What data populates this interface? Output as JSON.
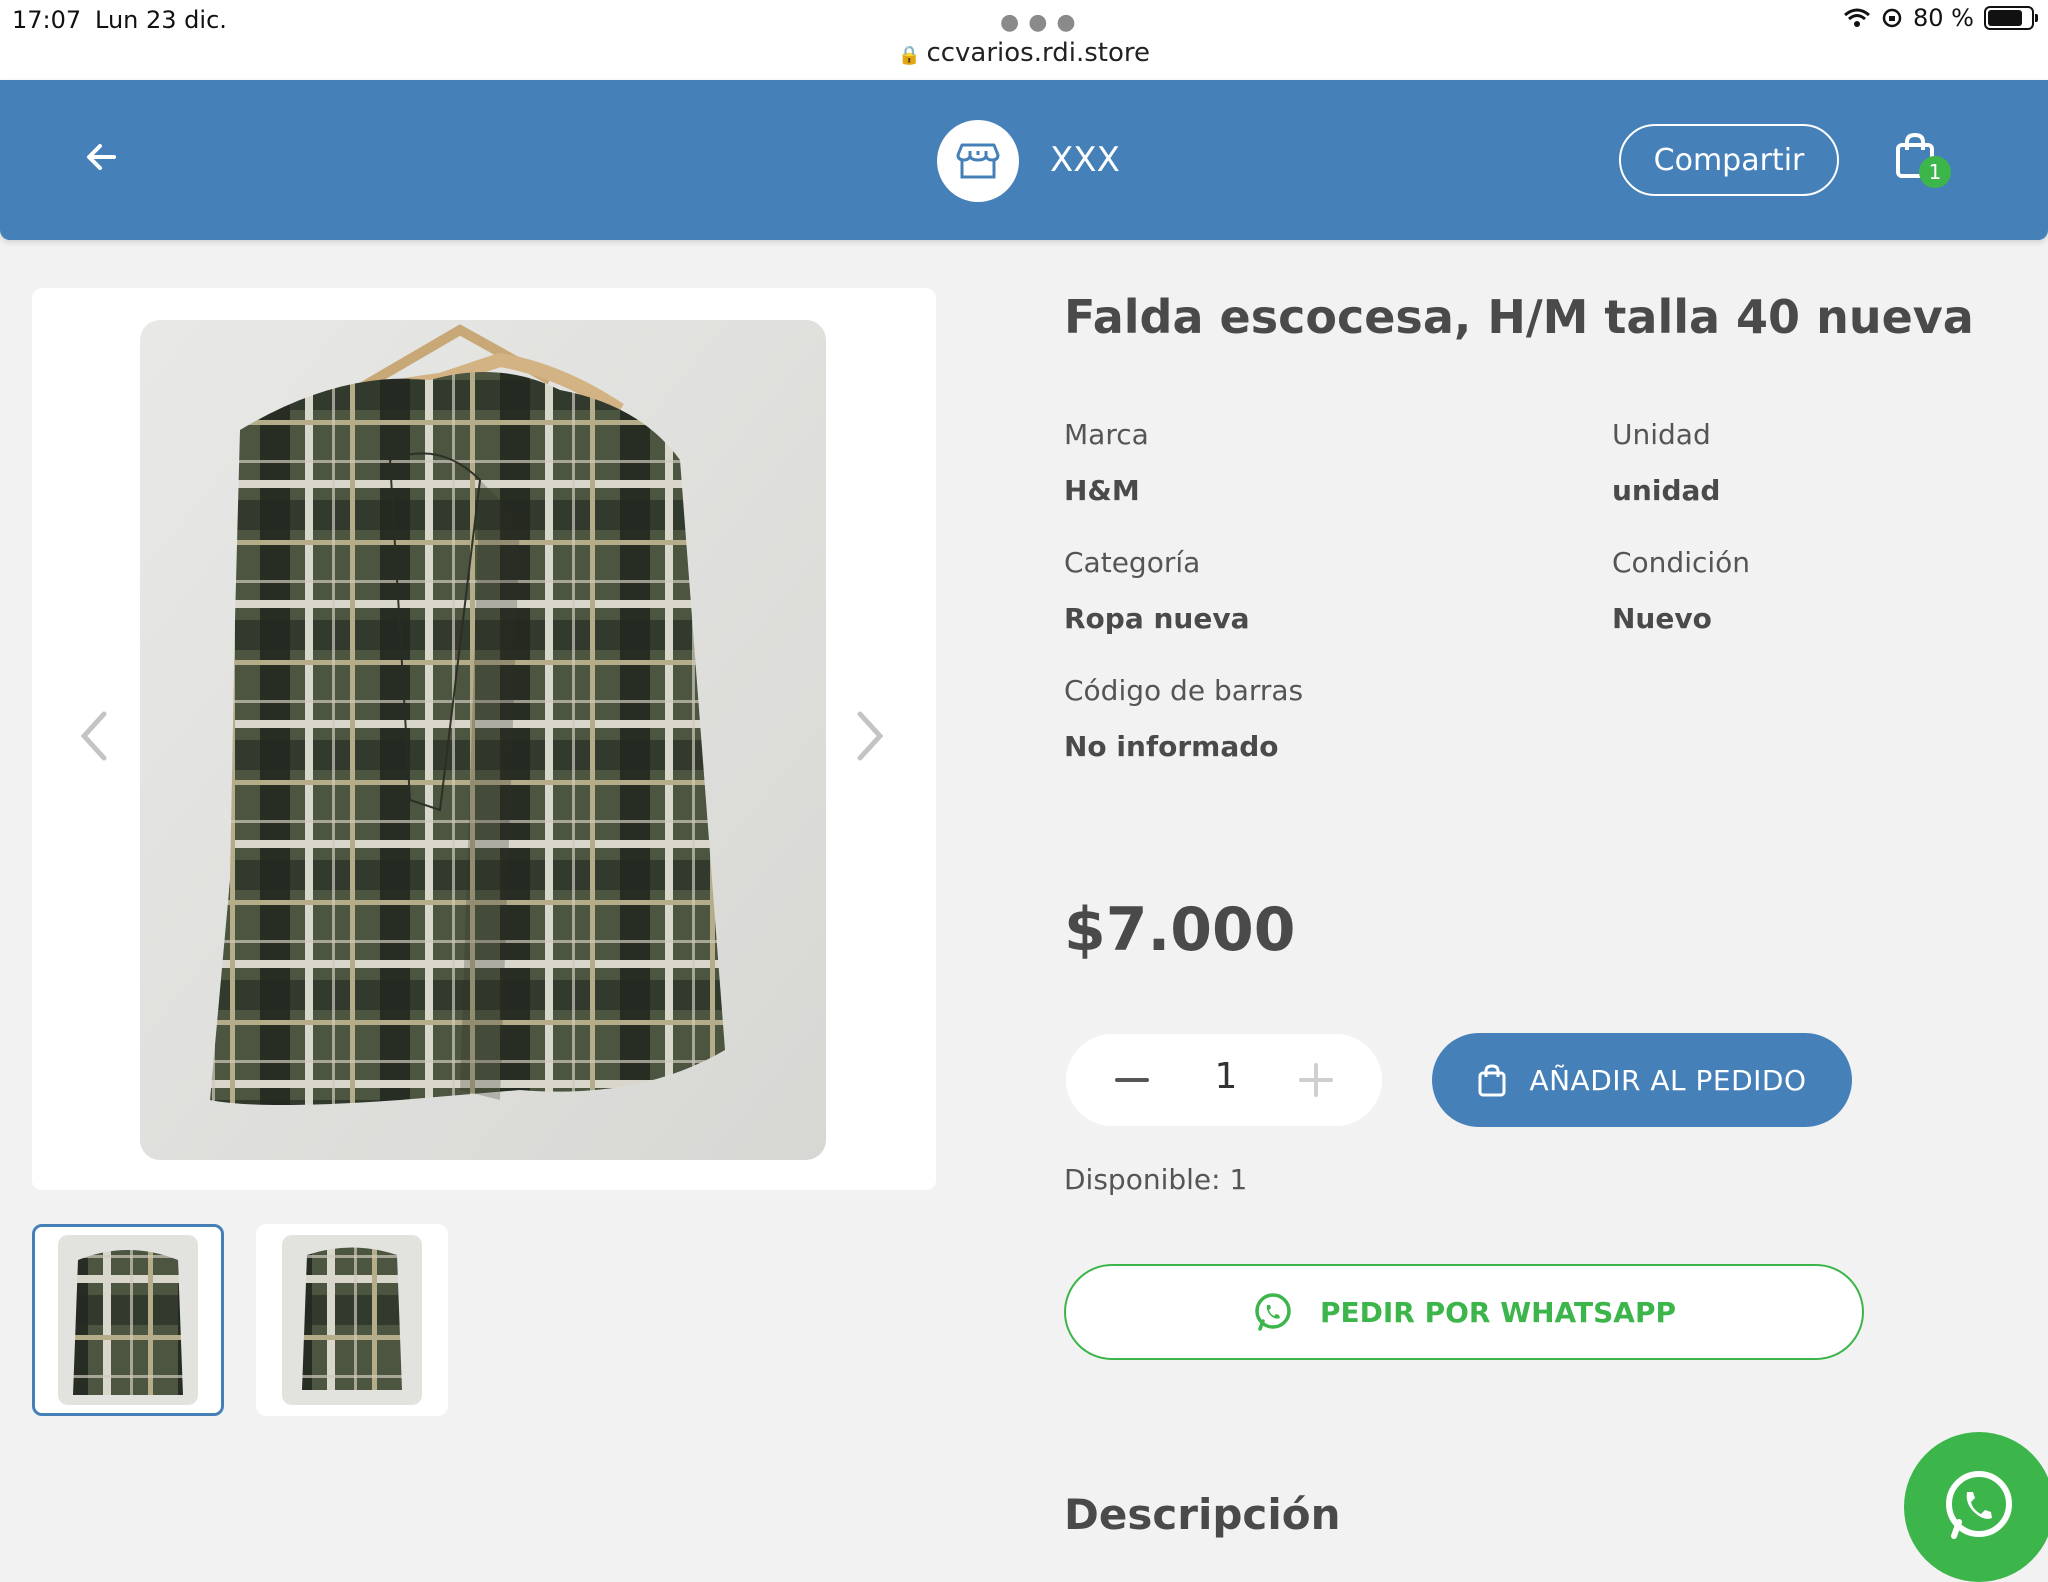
{
  "status_bar": {
    "time": "17:07",
    "date": "Lun 23 dic.",
    "url": "ccvarios.rdi.store",
    "battery": "80 %",
    "battery_level": 0.8
  },
  "header": {
    "store_name": "XXX",
    "share_label": "Compartir",
    "cart_count": "1",
    "accent_color": "#4680b9"
  },
  "product": {
    "title": "Falda escocesa, H/M talla 40 nueva",
    "specs": [
      {
        "label": "Marca",
        "value": "H&M"
      },
      {
        "label": "Unidad",
        "value": "unidad"
      },
      {
        "label": "Categoría",
        "value": "Ropa nueva"
      },
      {
        "label": "Condición",
        "value": "Nuevo"
      },
      {
        "label": "Código de barras",
        "value": "No informado"
      }
    ],
    "price": "$7.000",
    "quantity": "1",
    "add_label": "AÑADIR AL PEDIDO",
    "available": "Disponible: 1",
    "whatsapp_label": "PEDIR POR WHATSAPP",
    "description_heading": "Descripción"
  },
  "icons": {
    "back": "arrow-left-icon",
    "store": "store-icon",
    "cart": "shopping-bag-icon",
    "whatsapp": "whatsapp-icon",
    "prev": "chevron-left-icon",
    "next": "chevron-right-icon"
  },
  "colors": {
    "whatsapp_green": "#3cb54a",
    "background": "#f2f2f2"
  }
}
